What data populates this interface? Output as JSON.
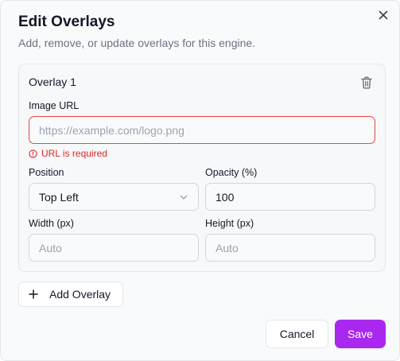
{
  "dialog": {
    "title": "Edit Overlays",
    "subtitle": "Add, remove, or update overlays for this engine."
  },
  "overlay": {
    "title": "Overlay 1",
    "image_url": {
      "label": "Image URL",
      "value": "",
      "placeholder": "https://example.com/logo.png",
      "error": "URL is required"
    },
    "position": {
      "label": "Position",
      "selected": "Top Left"
    },
    "opacity": {
      "label": "Opacity (%)",
      "value": "100"
    },
    "width": {
      "label": "Width (px)",
      "placeholder": "Auto"
    },
    "height": {
      "label": "Height (px)",
      "placeholder": "Auto"
    }
  },
  "actions": {
    "add_overlay": "Add Overlay",
    "cancel": "Cancel",
    "save": "Save"
  },
  "icons": {
    "close": "close-icon",
    "trash": "trash-icon",
    "error": "alert-circle-icon",
    "chevron": "chevron-down-icon",
    "plus": "plus-icon"
  },
  "colors": {
    "accent": "#a928f0",
    "error": "#dc2626",
    "error_border": "#ef4444"
  }
}
